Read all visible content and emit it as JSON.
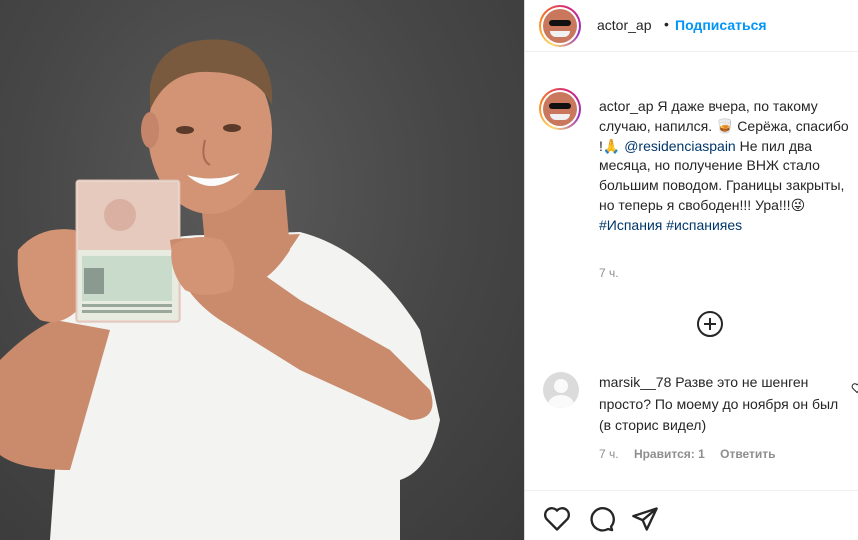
{
  "post": {
    "username": "actor_ap",
    "follow_label": "Подписаться",
    "separator": "•",
    "caption": {
      "username": "actor_ap",
      "line1": "Я даже вчера, по такому случаю, напился. 🥃 Серёжа, спасибо !🙏 ",
      "mention": "@residenciaspain",
      "line2": "Не пил два месяца, но получение ВНЖ стало большим поводом. Границы закрыты, но теперь я свободен!!! Ура!!!😜 ",
      "tag1": "#Испания",
      "tag2": "#испанияes",
      "time": "7 ч."
    },
    "comment": {
      "username": "marsik__78",
      "text": "Разве это не шенген просто? По моему до ноября он был (в сторис видел)",
      "time": "7 ч.",
      "likes": "Нравится: 1",
      "reply": "Ответить"
    },
    "icons": {
      "more": "plus-circle-icon",
      "like": "heart-icon",
      "comment": "comment-icon",
      "share": "share-icon",
      "comment_like": "heart-icon"
    },
    "colors": {
      "accent": "#0095f6",
      "link": "#00376b",
      "muted": "#8e8e8e",
      "text": "#262626"
    }
  }
}
